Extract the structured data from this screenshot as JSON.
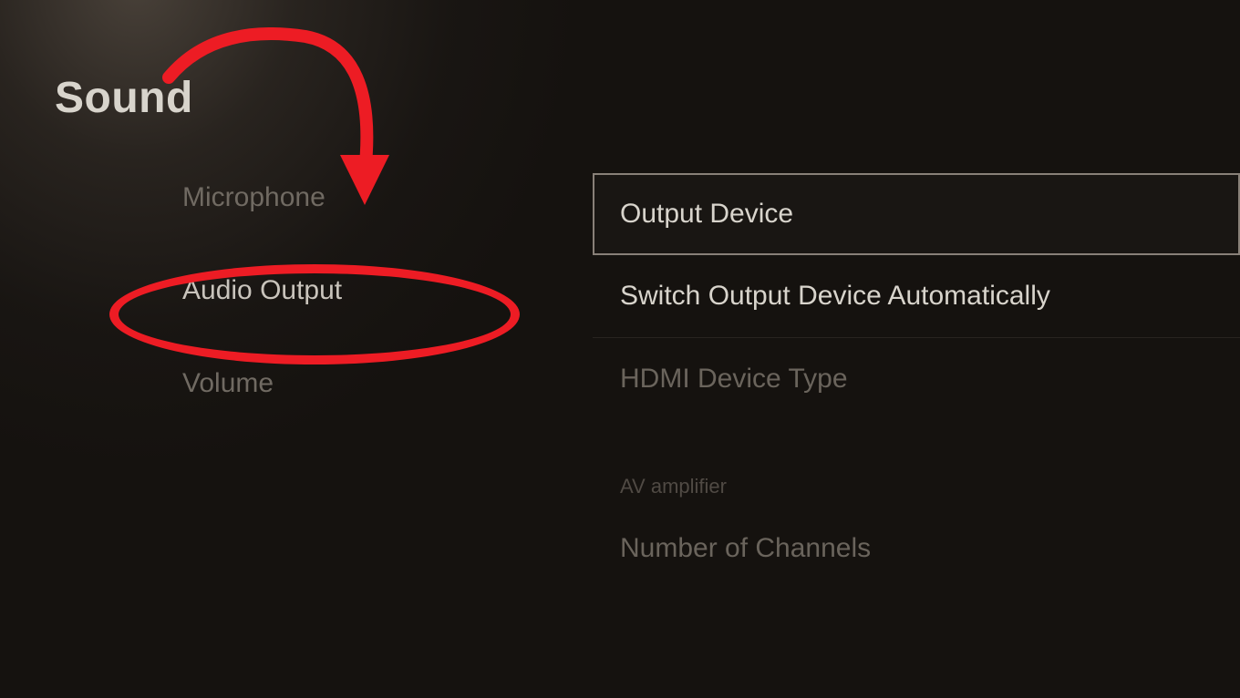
{
  "page": {
    "title": "Sound"
  },
  "sidebar": {
    "items": [
      {
        "label": "Microphone",
        "active": false
      },
      {
        "label": "Audio Output",
        "active": true
      },
      {
        "label": "Volume",
        "active": false
      }
    ]
  },
  "content": {
    "items": [
      {
        "label": "Output Device",
        "selected": true
      },
      {
        "label": "Switch Output Device Automatically",
        "selected": false
      },
      {
        "label": "HDMI Device Type",
        "dimmed": true
      }
    ],
    "section": {
      "label": "AV amplifier",
      "items": [
        {
          "label": "Number of Channels",
          "dimmed": true
        }
      ]
    }
  },
  "annotation": {
    "color": "#ed1c24"
  }
}
